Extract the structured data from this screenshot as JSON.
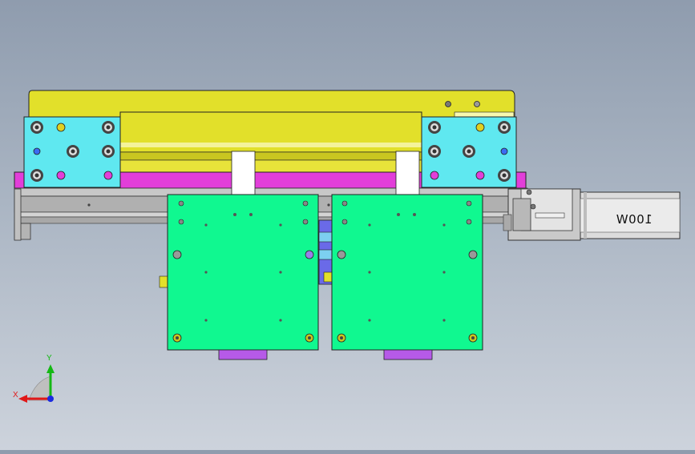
{
  "viewport": {
    "type": "cad-3d-view"
  },
  "motor": {
    "label": "100W"
  },
  "triad": {
    "x_label": "X",
    "y_label": "Y"
  },
  "colors": {
    "background_top": "#8f9cae",
    "background_bottom": "#cdd3dc",
    "top_plate": "#e2e02a",
    "mount_block": "#5fe8f0",
    "bearing_bar": "#e23ed9",
    "carriage": "#10f890",
    "purple_tab": "#b65ae8",
    "motor_body": "#dcdcdc",
    "rail": "#b8b8b8"
  }
}
